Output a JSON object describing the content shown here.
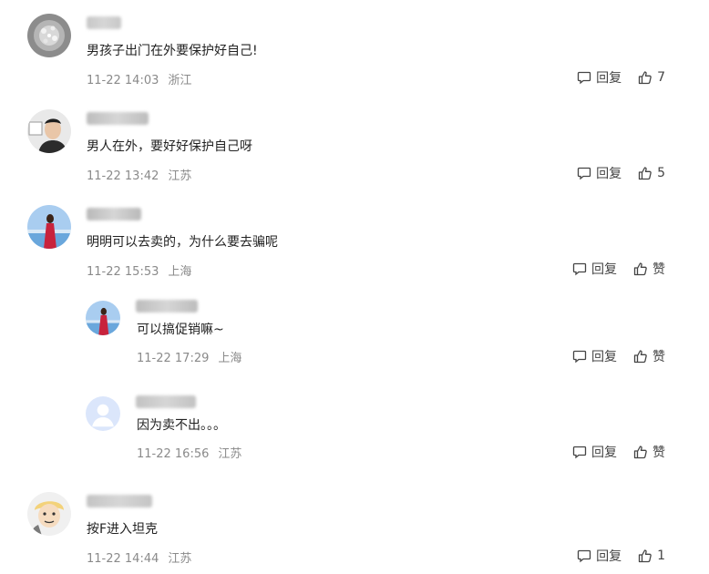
{
  "comments": [
    {
      "text": "男孩子出门在外要保护好自己!",
      "time": "11-22 14:03",
      "location": "浙江",
      "reply_label": "回复",
      "like_label": "7",
      "name_blur_color": "#c7c7c7",
      "level": 0,
      "avatar": "crystal-avatar"
    },
    {
      "text": "男人在外，要好好保护自己呀",
      "time": "11-22 13:42",
      "location": "江苏",
      "reply_label": "回复",
      "like_label": "5",
      "name_blur_color": "#bdbdbd",
      "level": 0,
      "avatar": "man-avatar"
    },
    {
      "text": "明明可以去卖的，为什么要去骗呢",
      "time": "11-22 15:53",
      "location": "上海",
      "reply_label": "回复",
      "like_label": "赞",
      "name_blur_color": "#b9b9b9",
      "level": 0,
      "avatar": "woman-sea-avatar"
    },
    {
      "text": "可以搞促销嘛~",
      "time": "11-22 17:29",
      "location": "上海",
      "reply_label": "回复",
      "like_label": "赞",
      "name_blur_color": "#bcbcbc",
      "level": 1,
      "avatar": "woman-sea-avatar"
    },
    {
      "text": "因为卖不出。。。",
      "time": "11-22 16:56",
      "location": "江苏",
      "reply_label": "回复",
      "like_label": "赞",
      "name_blur_color": "#c2c2c2",
      "level": 1,
      "avatar": "default-user-avatar"
    },
    {
      "text": "按F进入坦克",
      "time": "11-22 14:44",
      "location": "江苏",
      "reply_label": "回复",
      "like_label": "1",
      "name_blur_color": "#c4c4c4",
      "level": 0,
      "avatar": "cartoon-avatar"
    }
  ],
  "colors": {
    "meta_gray": "#8a8a8a",
    "text": "#222222",
    "default_avatar_bg": "#dbe6fb"
  }
}
